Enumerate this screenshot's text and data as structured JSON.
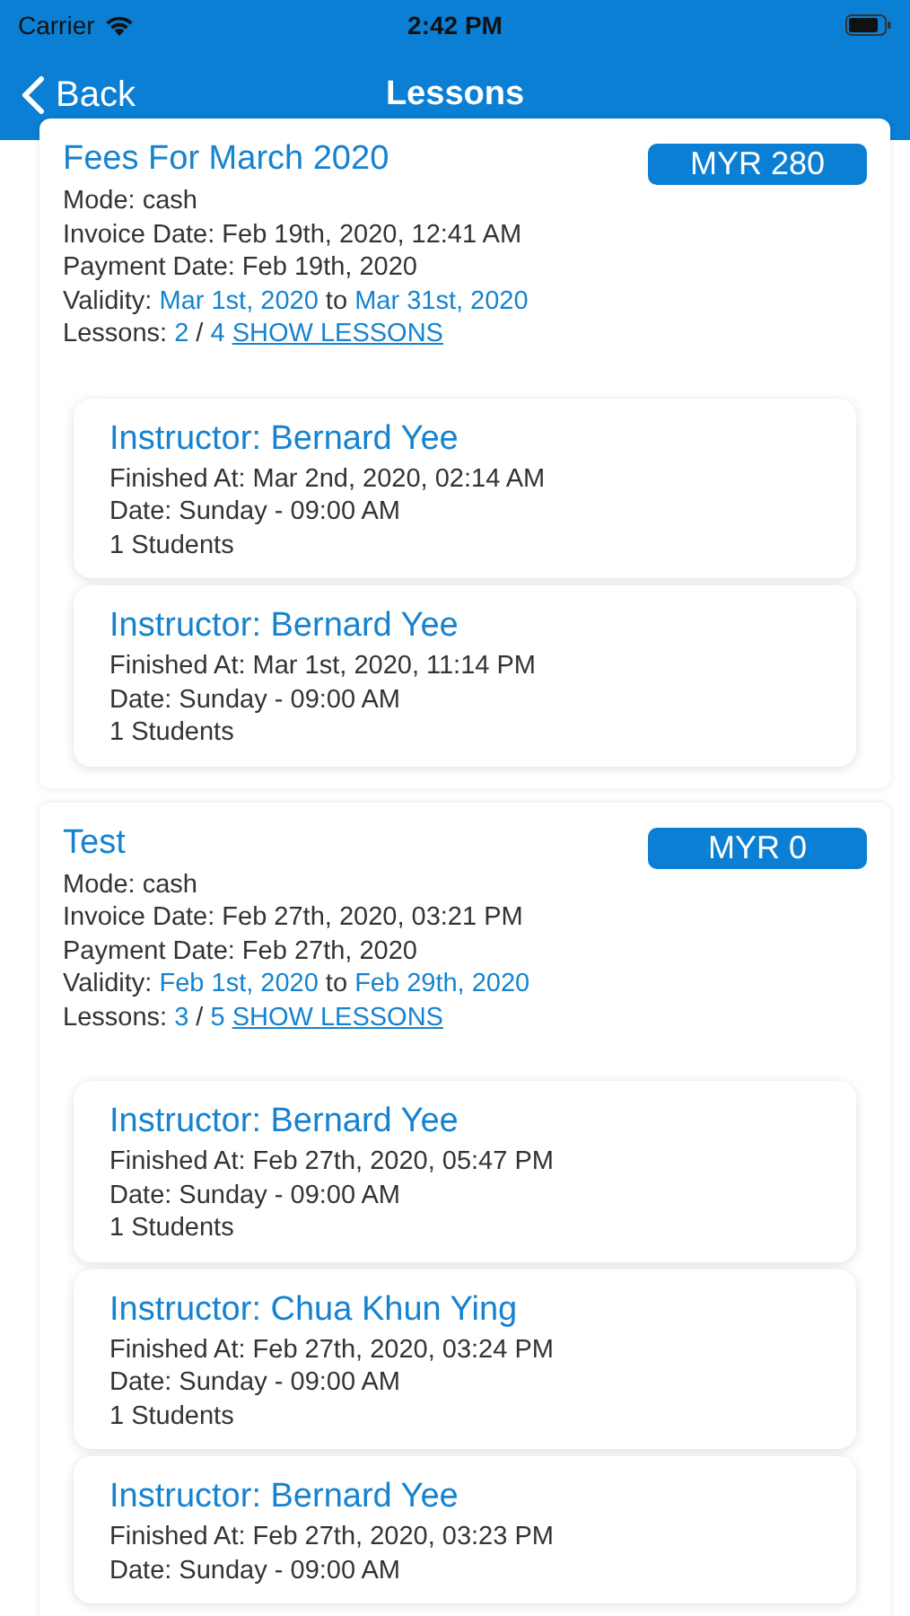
{
  "status_bar": {
    "carrier": "Carrier",
    "time": "2:42 PM"
  },
  "nav_bar": {
    "back": "Back",
    "title": "Lessons"
  },
  "invoices": [
    {
      "title": "Fees For March 2020",
      "amount": "MYR 280",
      "mode": "Mode: cash",
      "invoice_date": "Invoice Date: Feb 19th, 2020, 12:41 AM",
      "payment_date": "Payment Date: Feb 19th, 2020",
      "validity": {
        "label": "Validity:",
        "from": "Mar 1st, 2020",
        "connector": "to",
        "to": "Mar 31st, 2020"
      },
      "lessons": {
        "label": "Lessons:",
        "done": "2",
        "separator": "/",
        "total": "4",
        "link": "SHOW LESSONS"
      },
      "lesson_list": [
        {
          "instructor": "Instructor: Bernard Yee",
          "finished": "Finished At: Mar 2nd, 2020, 02:14 AM",
          "date": "Date: Sunday - 09:00 AM",
          "students": "1 Students"
        },
        {
          "instructor": "Instructor: Bernard Yee",
          "finished": "Finished At: Mar 1st, 2020, 11:14 PM",
          "date": "Date: Sunday - 09:00 AM",
          "students": "1 Students"
        }
      ]
    },
    {
      "title": "Test",
      "amount": "MYR 0",
      "mode": "Mode: cash",
      "invoice_date": "Invoice Date: Feb 27th, 2020, 03:21 PM",
      "payment_date": "Payment Date: Feb 27th, 2020",
      "validity": {
        "label": "Validity:",
        "from": "Feb 1st, 2020",
        "connector": "to",
        "to": "Feb 29th, 2020"
      },
      "lessons": {
        "label": "Lessons:",
        "done": "3",
        "separator": "/",
        "total": "5",
        "link": "SHOW LESSONS"
      },
      "lesson_list": [
        {
          "instructor": "Instructor: Bernard Yee",
          "finished": "Finished At: Feb 27th, 2020, 05:47 PM",
          "date": "Date: Sunday - 09:00 AM",
          "students": "1 Students"
        },
        {
          "instructor": "Instructor: Chua Khun Ying",
          "finished": "Finished At: Feb 27th, 2020, 03:24 PM",
          "date": "Date: Sunday - 09:00 AM",
          "students": "1 Students"
        },
        {
          "instructor": "Instructor: Bernard Yee",
          "finished": "Finished At: Feb 27th, 2020, 03:23 PM",
          "date": "Date: Sunday - 09:00 AM"
        }
      ]
    }
  ]
}
